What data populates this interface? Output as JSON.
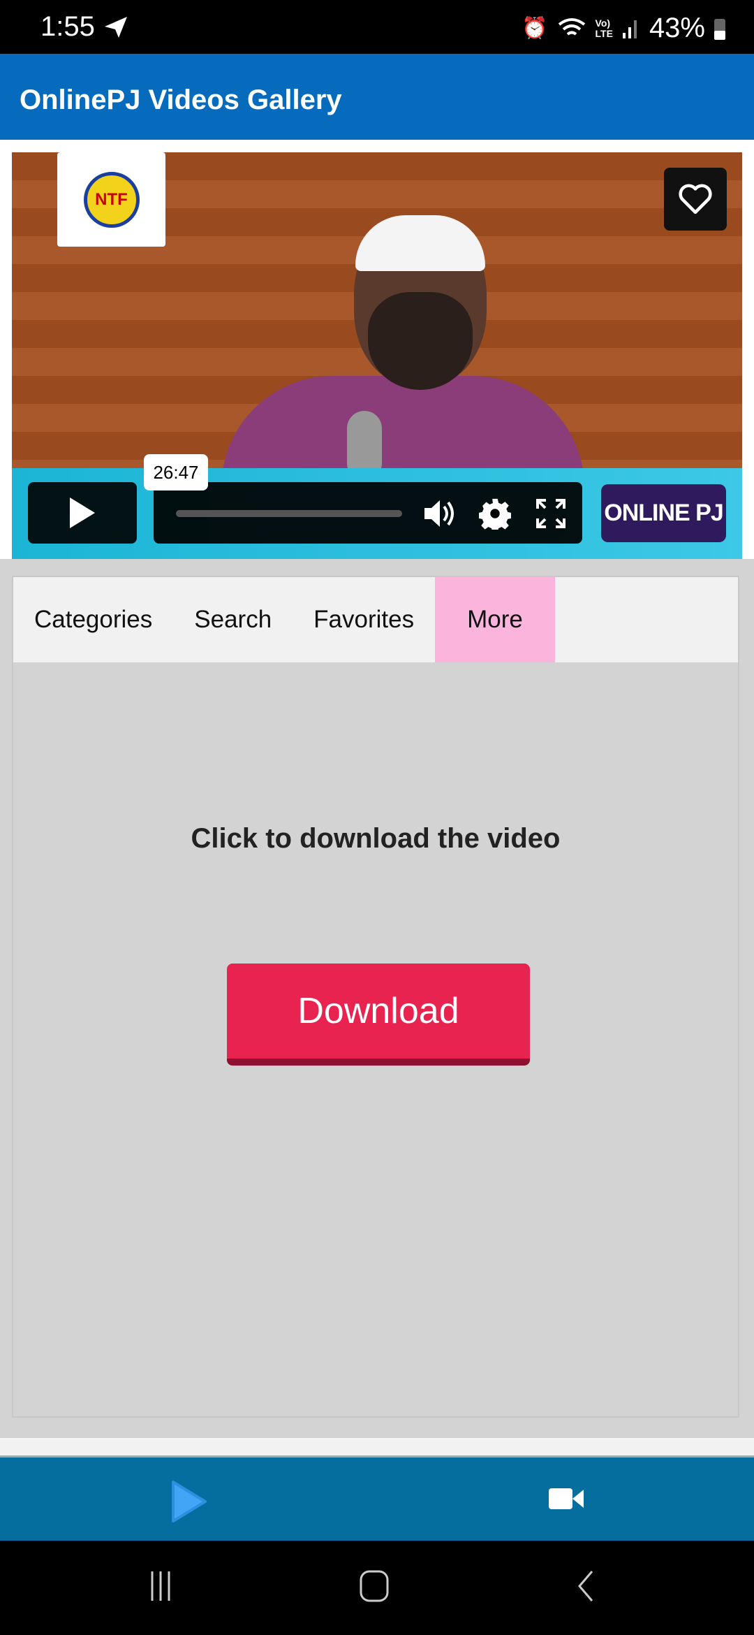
{
  "status_bar": {
    "time": "1:55",
    "battery": "43%",
    "icons": [
      "telegram-icon",
      "alarm-icon",
      "wifi-icon",
      "volte-icon",
      "signal-icon",
      "battery-icon"
    ]
  },
  "app_bar": {
    "title": "OnlinePJ Videos Gallery",
    "color": "#066bbd"
  },
  "video": {
    "logo_text": "NTF",
    "tooltip_time": "26:47",
    "badge": "ONLINE PJ",
    "progress": 0
  },
  "tabs": [
    {
      "label": "Categories"
    },
    {
      "label": "Search"
    },
    {
      "label": "Favorites"
    },
    {
      "label": "More",
      "active": true
    }
  ],
  "more": {
    "message": "Click to download the video",
    "download_label": "Download",
    "button_color": "#e8234f"
  },
  "bottom_nav": {
    "items": [
      "play-icon",
      "video-camera-icon"
    ],
    "color": "#066e9e"
  }
}
